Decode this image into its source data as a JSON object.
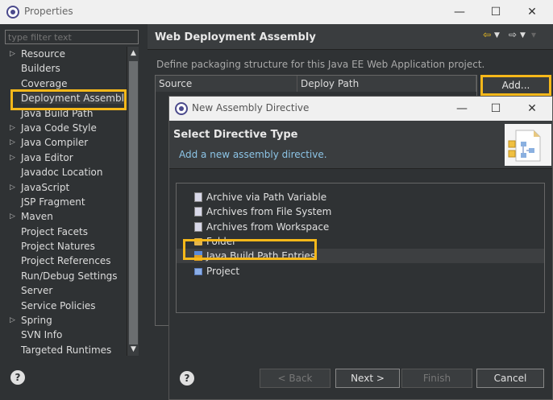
{
  "properties_window": {
    "title": "Properties",
    "controls": {
      "minimize": "—",
      "maximize": "☐",
      "close": "✕"
    },
    "filter_placeholder": "type filter text",
    "tree": [
      {
        "label": "Resource",
        "expandable": true
      },
      {
        "label": "Builders",
        "expandable": false
      },
      {
        "label": "Coverage",
        "expandable": false
      },
      {
        "label": "Deployment Assembly",
        "expandable": false,
        "selected": true
      },
      {
        "label": "Java Build Path",
        "expandable": false
      },
      {
        "label": "Java Code Style",
        "expandable": true
      },
      {
        "label": "Java Compiler",
        "expandable": true
      },
      {
        "label": "Java Editor",
        "expandable": true
      },
      {
        "label": "Javadoc Location",
        "expandable": false
      },
      {
        "label": "JavaScript",
        "expandable": true
      },
      {
        "label": "JSP Fragment",
        "expandable": false
      },
      {
        "label": "Maven",
        "expandable": true
      },
      {
        "label": "Project Facets",
        "expandable": false
      },
      {
        "label": "Project Natures",
        "expandable": false
      },
      {
        "label": "Project References",
        "expandable": false
      },
      {
        "label": "Run/Debug Settings",
        "expandable": false
      },
      {
        "label": "Server",
        "expandable": false
      },
      {
        "label": "Service Policies",
        "expandable": false
      },
      {
        "label": "Spring",
        "expandable": true
      },
      {
        "label": "SVN Info",
        "expandable": false
      },
      {
        "label": "Targeted Runtimes",
        "expandable": false
      }
    ],
    "page_title": "Web Deployment Assembly",
    "description": "Define packaging structure for this Java EE Web Application project.",
    "table_columns": [
      "Source",
      "Deploy Path"
    ],
    "add_button": "Add..."
  },
  "dialog": {
    "title": "New Assembly Directive",
    "controls": {
      "minimize": "—",
      "maximize": "☐",
      "close": "✕"
    },
    "header_title": "Select Directive Type",
    "header_subtitle": "Add a new assembly directive.",
    "directives": [
      {
        "label": "Archive via Path Variable",
        "icon": "archive-icon"
      },
      {
        "label": "Archives from File System",
        "icon": "archive-icon"
      },
      {
        "label": "Archives from Workspace",
        "icon": "archive-icon"
      },
      {
        "label": "Folder",
        "icon": "folder-icon"
      },
      {
        "label": "Java Build Path Entries",
        "icon": "java-library-icon",
        "selected": true
      },
      {
        "label": "Project",
        "icon": "project-icon"
      }
    ],
    "buttons": {
      "back": "< Back",
      "next": "Next >",
      "finish": "Finish",
      "cancel": "Cancel"
    }
  },
  "colors": {
    "highlight": "#f6b81a",
    "background": "#2f3234",
    "subtitle": "#8cc4e6"
  }
}
